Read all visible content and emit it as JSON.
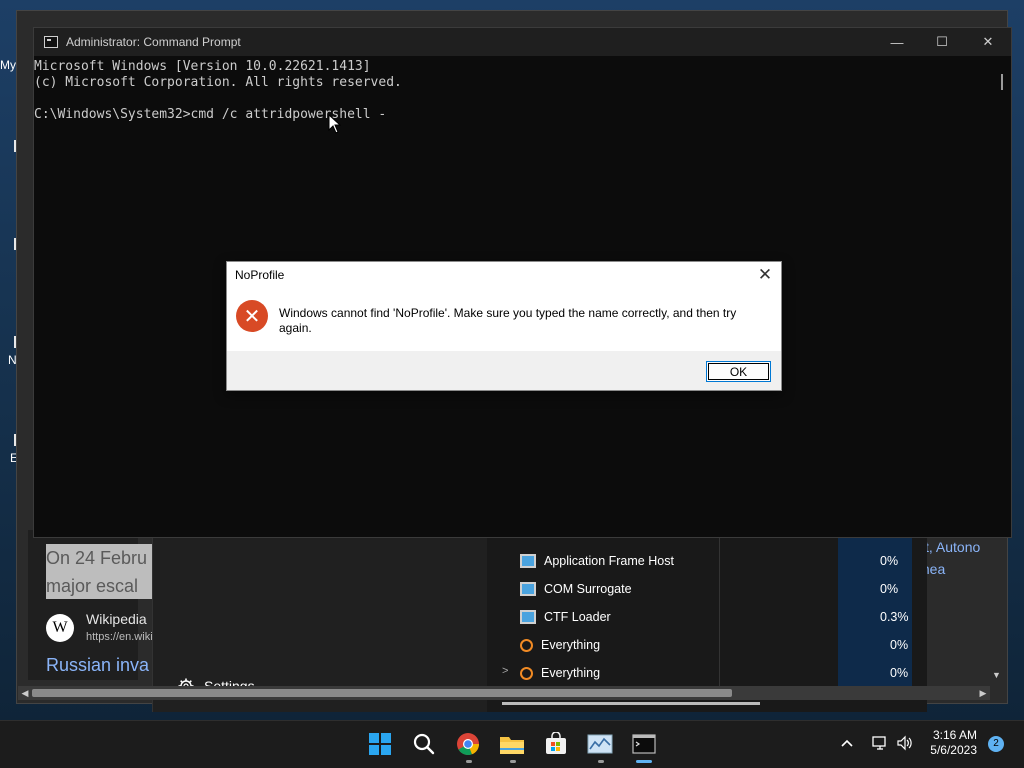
{
  "desktop": {
    "icon_labels": [
      "My",
      "N",
      "E"
    ]
  },
  "browser": {
    "snippet_lines": [
      "On 24 Febru",
      "major escal"
    ],
    "wiki_logo": "W",
    "wiki_name": "Wikipedia",
    "wiki_url": "https://en.wiki",
    "wiki_link": "Russian inva",
    "right_snippet": "st, Autono mea"
  },
  "start_menu": {
    "settings_label": "Settings"
  },
  "task_manager": {
    "rows": [
      {
        "name": "Application Frame Host",
        "cpu": "0%",
        "icon": "app-window-icon"
      },
      {
        "name": "COM Surrogate",
        "cpu": "0%",
        "icon": "app-window-icon"
      },
      {
        "name": "CTF Loader",
        "cpu": "0.3%",
        "icon": "app-window-icon"
      },
      {
        "name": "Everything",
        "cpu": "0%",
        "icon": "search-magnifier-icon"
      },
      {
        "name": "Everything",
        "cpu": "0%",
        "icon": "search-magnifier-icon"
      }
    ]
  },
  "cmd": {
    "title": "Administrator: Command Prompt",
    "lines": [
      "Microsoft Windows [Version 10.0.22621.1413]",
      "(c) Microsoft Corporation. All rights reserved.",
      "",
      "C:\\Windows\\System32>cmd /c attridpowershell -"
    ],
    "minimize": "—",
    "maximize": "☐",
    "close": "✕"
  },
  "dialog": {
    "title": "NoProfile",
    "message": "Windows cannot find 'NoProfile'. Make sure you typed the name correctly, and then try again.",
    "ok_label": "OK",
    "close": "✕",
    "error_glyph": "✕"
  },
  "taskbar": {
    "apps": [
      "start-icon",
      "search-icon",
      "chrome-icon",
      "file-explorer-icon",
      "microsoft-store-icon",
      "resource-monitor-icon",
      "terminal-icon"
    ],
    "tray_chevron": "^",
    "time": "3:16 AM",
    "date": "5/6/2023",
    "notifications": "2"
  },
  "colors": {
    "cmd_bg": "#0c0c0c",
    "cmd_text": "#cccccc",
    "error_red": "#d84a25",
    "accent": "#0078d4"
  }
}
